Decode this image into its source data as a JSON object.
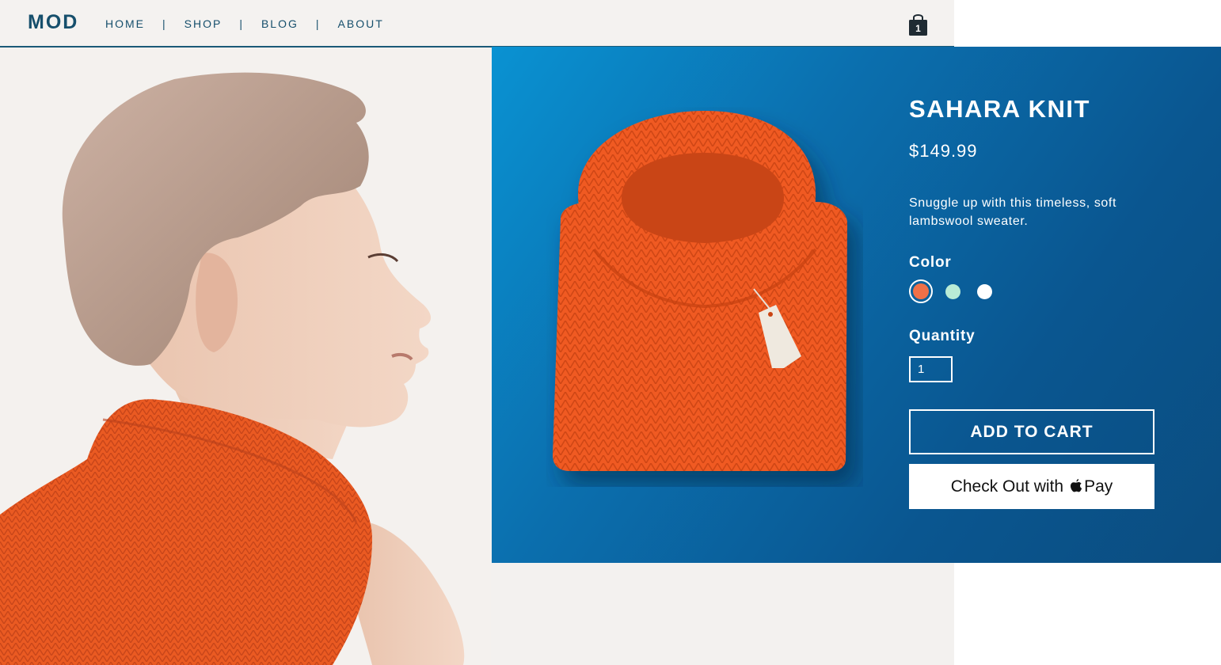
{
  "header": {
    "logo": "MOD",
    "nav": [
      {
        "label": "HOME"
      },
      {
        "label": "SHOP"
      },
      {
        "label": "BLOG"
      },
      {
        "label": "ABOUT"
      }
    ],
    "separator": "|",
    "cart_count": "1",
    "cart_icon": "shopping-bag-icon"
  },
  "product": {
    "name": "SAHARA KNIT",
    "price": "$149.99",
    "description": "Snuggle up with this timeless, soft lambswool sweater.",
    "color_label": "Color",
    "colors": [
      {
        "name": "orange",
        "hex": "#f07048",
        "selected": true
      },
      {
        "name": "mint",
        "hex": "#b9ecd6",
        "selected": false
      },
      {
        "name": "white",
        "hex": "#ffffff",
        "selected": false
      }
    ],
    "quantity_label": "Quantity",
    "quantity": "1",
    "add_to_cart": "ADD TO CART",
    "checkout_prefix": "Check Out with",
    "checkout_suffix": "Pay",
    "pay_icon": "apple-icon"
  },
  "colors": {
    "brand": "#164f6c",
    "panel_blue": "#0b6fae",
    "sweater_orange": "#f0582a"
  }
}
